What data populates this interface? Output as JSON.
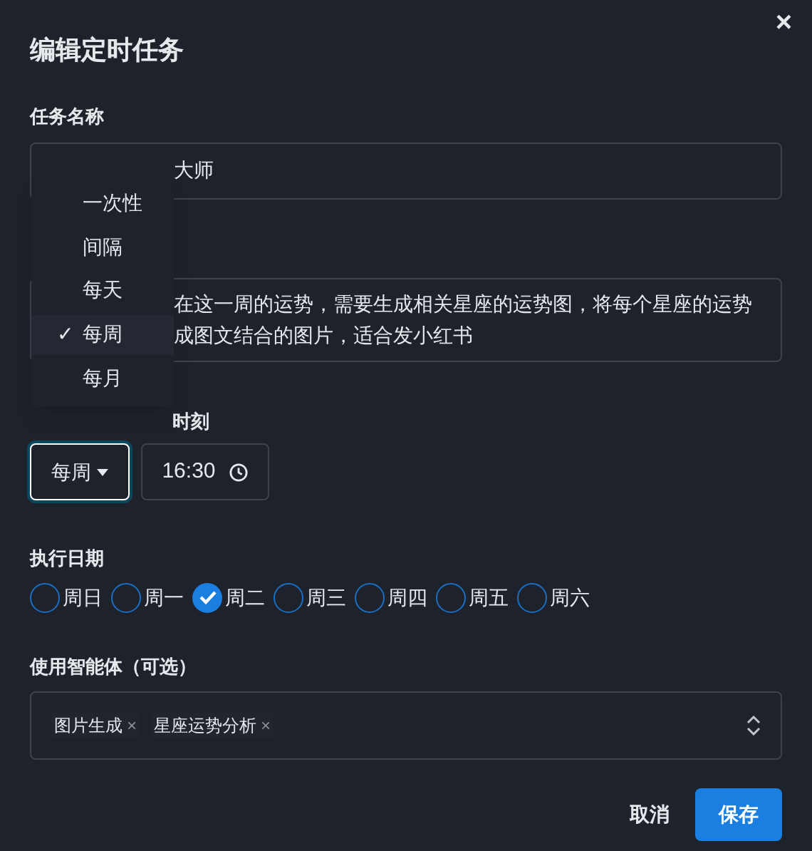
{
  "dialog": {
    "title": "编辑定时任务",
    "close": "×"
  },
  "task_name": {
    "label": "任务名称",
    "value": "大师"
  },
  "description": {
    "lines": [
      "在这一周的运势，需要生成相关星座的运势图，将每个星座的运势",
      "成图文结合的图片，适合发小红书"
    ]
  },
  "schedule": {
    "time_label": "时刻",
    "frequency": "每周",
    "time": "16:30"
  },
  "frequency_menu": [
    {
      "label": "一次性",
      "selected": false
    },
    {
      "label": "间隔",
      "selected": false
    },
    {
      "label": "每天",
      "selected": false
    },
    {
      "label": "每周",
      "selected": true
    },
    {
      "label": "每月",
      "selected": false
    }
  ],
  "check_mark": "✓",
  "days": {
    "label": "执行日期",
    "items": [
      {
        "label": "周日",
        "checked": false
      },
      {
        "label": "周一",
        "checked": false
      },
      {
        "label": "周二",
        "checked": true
      },
      {
        "label": "周三",
        "checked": false
      },
      {
        "label": "周四",
        "checked": false
      },
      {
        "label": "周五",
        "checked": false
      },
      {
        "label": "周六",
        "checked": false
      }
    ]
  },
  "agents": {
    "label": "使用智能体（可选）",
    "tags": [
      "图片生成",
      "星座运势分析"
    ],
    "remove": "×"
  },
  "buttons": {
    "cancel": "取消",
    "save": "保存"
  }
}
